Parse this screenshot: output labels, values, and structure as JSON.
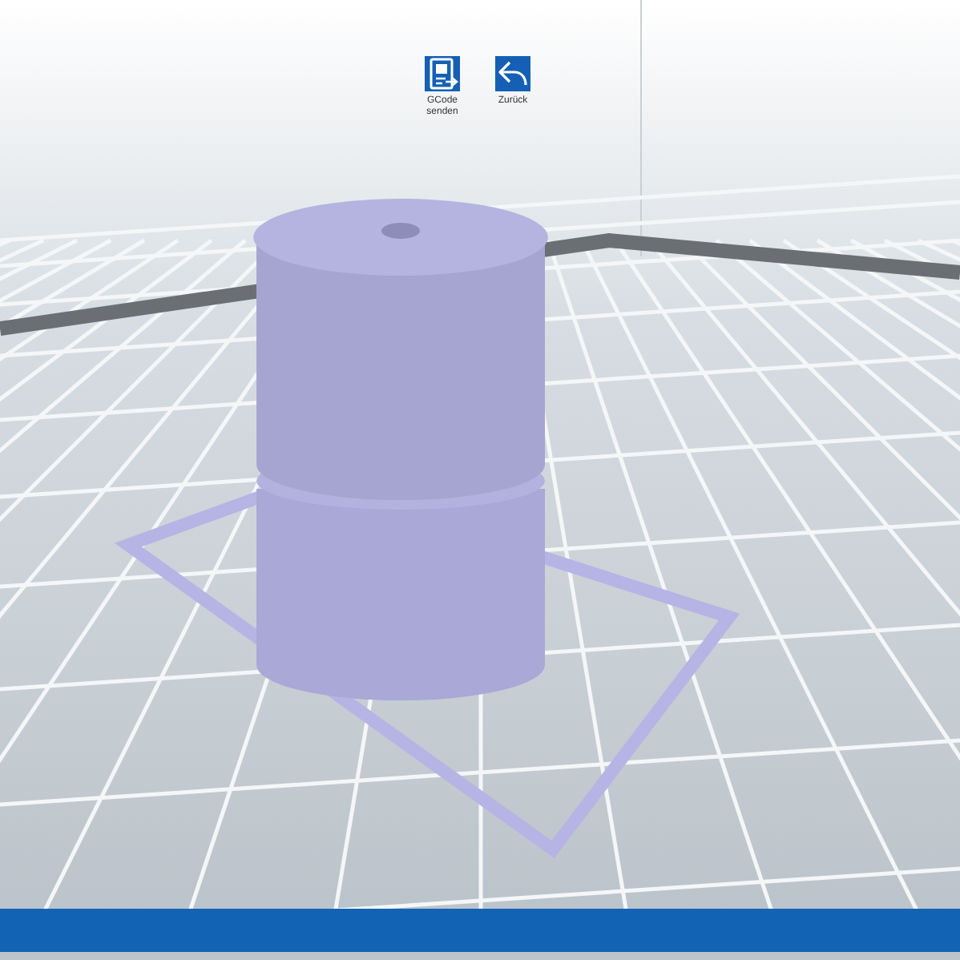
{
  "toolbar": {
    "buttons": [
      {
        "kind": "gcode",
        "label": "GCode senden"
      },
      {
        "kind": "back",
        "label": "Zurück"
      }
    ]
  }
}
